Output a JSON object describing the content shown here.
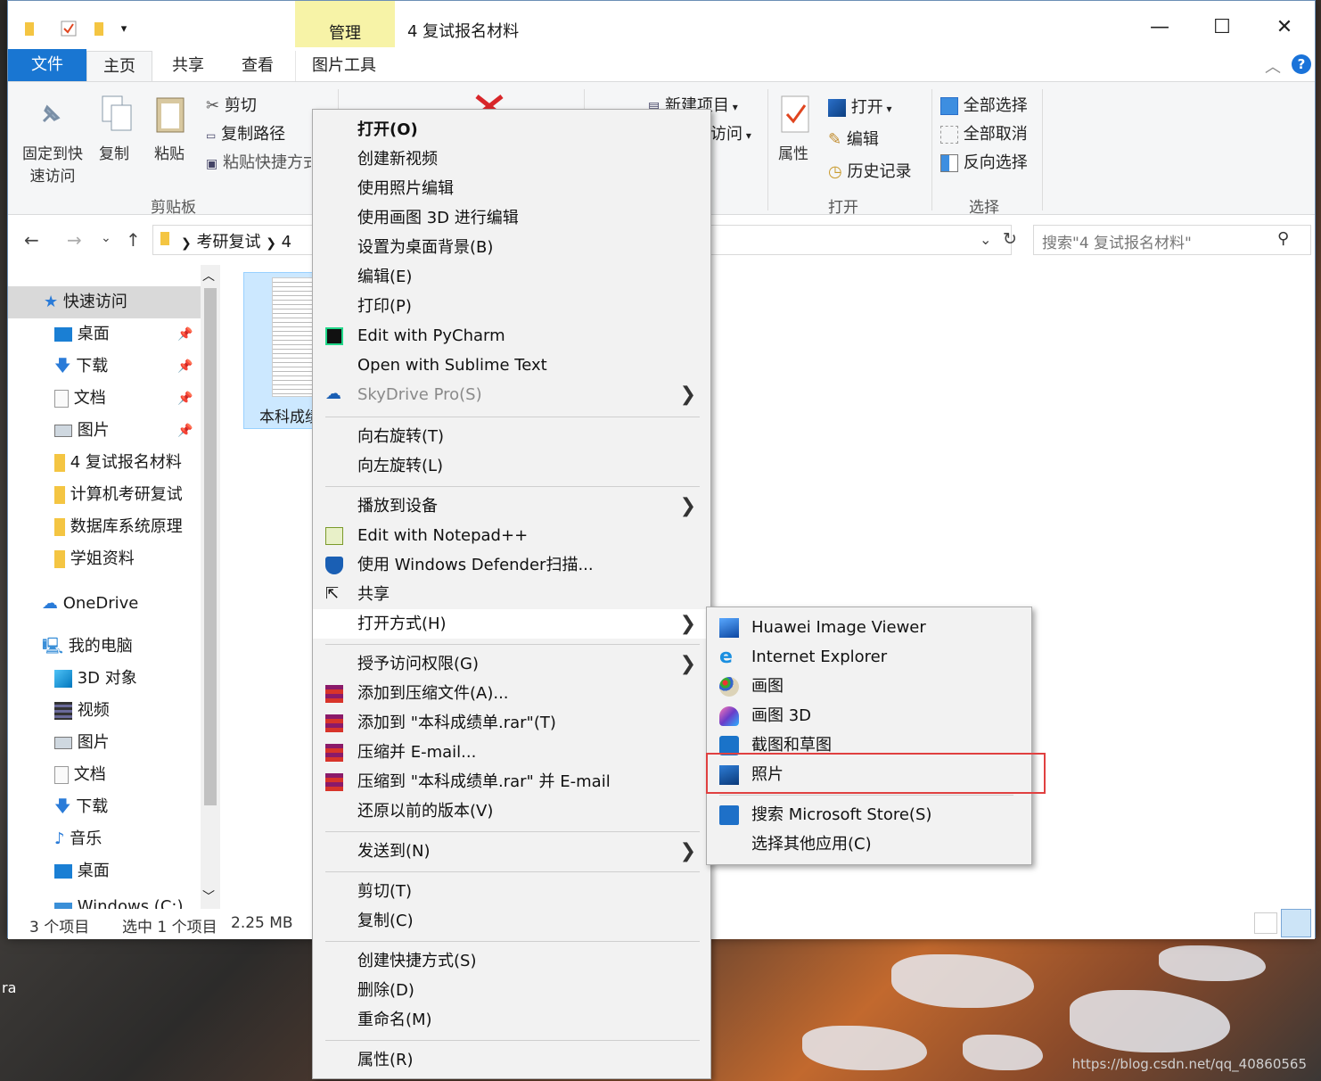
{
  "window": {
    "title": "4 复试报名材料",
    "context_tab": "管理",
    "controls": {
      "minimize": "—",
      "maximize": "☐",
      "close": "✕"
    }
  },
  "tabs": {
    "file": "文件",
    "home": "主页",
    "share": "共享",
    "view": "查看",
    "picture_tools": "图片工具"
  },
  "ribbon": {
    "pin_quick_line1": "固定到快",
    "pin_quick_line2": "速访问",
    "copy": "复制",
    "paste": "粘贴",
    "cut": "剪切",
    "copy_path": "复制路径",
    "paste_shortcut": "粘贴快捷方式",
    "clipboard_group": "剪贴板",
    "new_item": "新建项目",
    "easy_access": "访问",
    "properties": "属性",
    "open": "打开",
    "edit": "编辑",
    "history": "历史记录",
    "open_group": "打开",
    "select_all": "全部选择",
    "select_none": "全部取消",
    "invert_selection": "反向选择",
    "select_group": "选择"
  },
  "address": {
    "crumb1": "考研复试",
    "crumb2": "4",
    "search_placeholder": "搜索\"4 复试报名材料\""
  },
  "nav": {
    "quick_access": "快速访问",
    "desktop": "桌面",
    "downloads": "下载",
    "documents": "文档",
    "pictures": "图片",
    "folder1": "4 复试报名材料",
    "folder2": "计算机考研复试",
    "folder3": "数据库系统原理",
    "folder4": "学姐资料",
    "onedrive": "OneDrive",
    "this_pc": "我的电脑",
    "objects3d": "3D 对象",
    "videos": "视频",
    "pictures2": "图片",
    "documents2": "文档",
    "downloads2": "下载",
    "music": "音乐",
    "desktop2": "桌面",
    "drive_c": "Windows (C:)"
  },
  "content": {
    "file_label": "本科成绩单"
  },
  "status": {
    "count": "3 个项目",
    "selected": "选中 1 个项目",
    "size": "2.25 MB"
  },
  "context_menu": {
    "items": [
      "打开(O)",
      "创建新视频",
      "使用照片编辑",
      "使用画图 3D 进行编辑",
      "设置为桌面背景(B)",
      "编辑(E)",
      "打印(P)",
      "Edit with PyCharm",
      "Open with Sublime Text",
      "SkyDrive Pro(S)",
      "向右旋转(T)",
      "向左旋转(L)",
      "播放到设备",
      "Edit with Notepad++",
      "使用 Windows Defender扫描...",
      "共享",
      "打开方式(H)",
      "授予访问权限(G)",
      "添加到压缩文件(A)...",
      "添加到 \"本科成绩单.rar\"(T)",
      "压缩并 E-mail...",
      "压缩到 \"本科成绩单.rar\" 并 E-mail",
      "还原以前的版本(V)",
      "发送到(N)",
      "剪切(T)",
      "复制(C)",
      "创建快捷方式(S)",
      "删除(D)",
      "重命名(M)",
      "属性(R)"
    ],
    "submenu_arrow": "❯"
  },
  "open_with": {
    "items": [
      "Huawei Image Viewer",
      "Internet Explorer",
      "画图",
      "画图 3D",
      "截图和草图",
      "照片",
      "搜索 Microsoft Store(S)",
      "选择其他应用(C)"
    ]
  },
  "desktop": {
    "label": "ra",
    "watermark": "https://blog.csdn.net/qq_40860565"
  },
  "colors": {
    "accent": "#1976d2",
    "manage_band": "#f7f3a7",
    "highlight": "#e04040",
    "menu_bg": "#f2f2f2"
  }
}
